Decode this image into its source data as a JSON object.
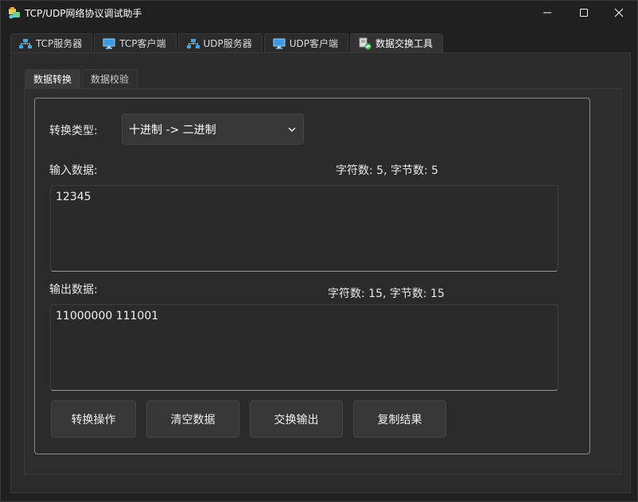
{
  "window": {
    "title": "TCP/UDP网络协议调试助手",
    "controls": [
      "minimize",
      "maximize",
      "close"
    ]
  },
  "top_tabs": [
    {
      "label": "TCP服务器",
      "icon": "network-icon",
      "active": false
    },
    {
      "label": "TCP客户端",
      "icon": "monitor-icon",
      "active": false
    },
    {
      "label": "UDP服务器",
      "icon": "network-icon",
      "active": false
    },
    {
      "label": "UDP客户端",
      "icon": "monitor-icon",
      "active": false
    },
    {
      "label": "数据交换工具",
      "icon": "document-exchange-icon",
      "active": true
    }
  ],
  "inner_tabs": [
    {
      "label": "数据转换",
      "active": true
    },
    {
      "label": "数据校验",
      "active": false
    }
  ],
  "converter": {
    "type_label": "转换类型:",
    "type_value": "十进制 -> 二进制",
    "input_label": "输入数据:",
    "input_stats": "字符数: 5, 字节数: 5",
    "input_value": "12345",
    "output_label": "输出数据:",
    "output_stats": "字符数: 15, 字节数: 15",
    "output_value": "11000000 111001"
  },
  "buttons": {
    "convert": "转换操作",
    "clear": "清空数据",
    "swap": "交换输出",
    "copy": "复制结果"
  },
  "colors": {
    "background": "#202020",
    "panel": "#2b2b2b",
    "control": "#373737",
    "text": "#e6e6e6"
  }
}
